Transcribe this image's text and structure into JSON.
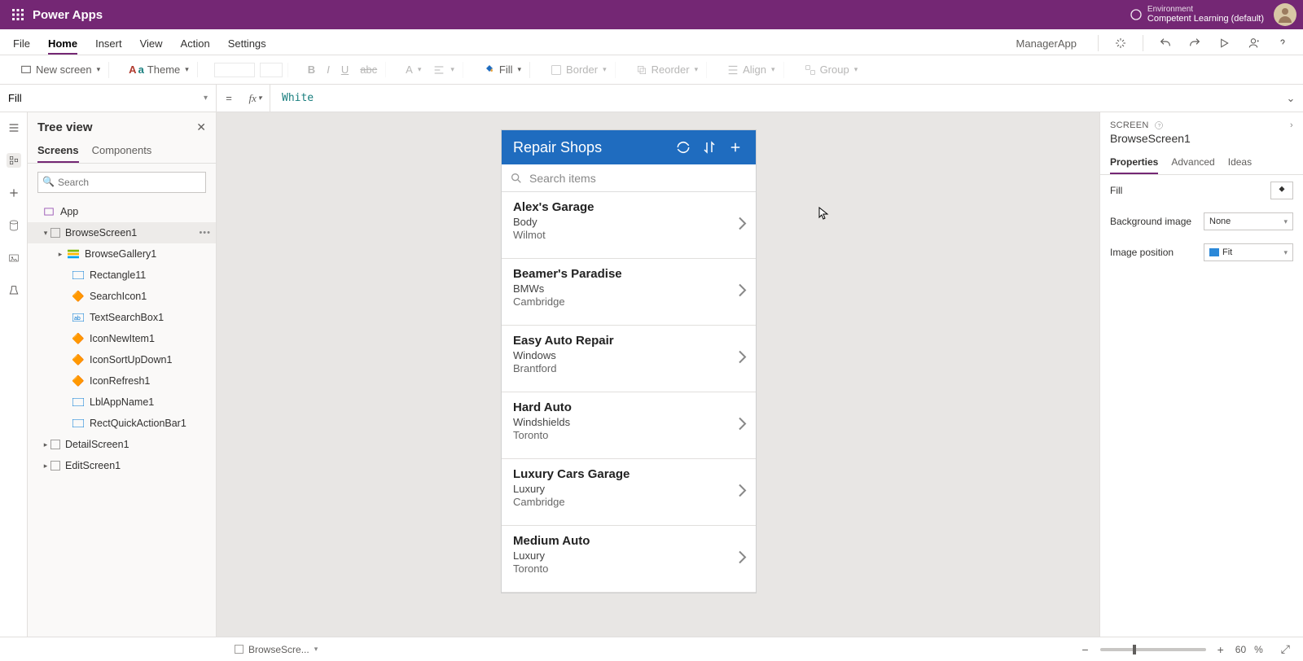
{
  "titlebar": {
    "app": "Power Apps",
    "env_label": "Environment",
    "env_name": "Competent Learning (default)"
  },
  "menubar": {
    "items": [
      "File",
      "Home",
      "Insert",
      "View",
      "Action",
      "Settings"
    ],
    "active_index": 1,
    "docname": "ManagerApp"
  },
  "ribbon": {
    "newscreen": "New screen",
    "theme": "Theme",
    "fill": "Fill",
    "border": "Border",
    "reorder": "Reorder",
    "align": "Align",
    "group": "Group"
  },
  "formula": {
    "property": "Fill",
    "expr": "White"
  },
  "tree": {
    "title": "Tree view",
    "tabs": [
      "Screens",
      "Components"
    ],
    "active_tab": 0,
    "search_ph": "Search",
    "app": "App",
    "screens": [
      {
        "name": "BrowseScreen1",
        "selected": true,
        "children": [
          {
            "name": "BrowseGallery1",
            "k": "gallery",
            "expandable": true
          },
          {
            "name": "Rectangle11",
            "k": "rect"
          },
          {
            "name": "SearchIcon1",
            "k": "icon"
          },
          {
            "name": "TextSearchBox1",
            "k": "text"
          },
          {
            "name": "IconNewItem1",
            "k": "icon"
          },
          {
            "name": "IconSortUpDown1",
            "k": "icon"
          },
          {
            "name": "IconRefresh1",
            "k": "icon"
          },
          {
            "name": "LblAppName1",
            "k": "label"
          },
          {
            "name": "RectQuickActionBar1",
            "k": "rect"
          }
        ]
      },
      {
        "name": "DetailScreen1"
      },
      {
        "name": "EditScreen1"
      }
    ]
  },
  "canvas": {
    "apptitle": "Repair Shops",
    "search_ph": "Search items",
    "items": [
      {
        "title": "Alex's Garage",
        "sub": "Body",
        "loc": "Wilmot"
      },
      {
        "title": "Beamer's Paradise",
        "sub": "BMWs",
        "loc": "Cambridge"
      },
      {
        "title": "Easy Auto Repair",
        "sub": "Windows",
        "loc": "Brantford"
      },
      {
        "title": "Hard Auto",
        "sub": "Windshields",
        "loc": "Toronto"
      },
      {
        "title": "Luxury Cars Garage",
        "sub": "Luxury",
        "loc": "Cambridge"
      },
      {
        "title": "Medium Auto",
        "sub": "Luxury",
        "loc": "Toronto"
      }
    ]
  },
  "props": {
    "heading": "SCREEN",
    "name": "BrowseScreen1",
    "tabs": [
      "Properties",
      "Advanced",
      "Ideas"
    ],
    "active_tab": 0,
    "rows": {
      "fill_label": "Fill",
      "bg_label": "Background image",
      "bg_value": "None",
      "pos_label": "Image position",
      "pos_value": "Fit"
    }
  },
  "status": {
    "selection": "BrowseScre...",
    "zoom": "60",
    "zoom_unit": "%"
  }
}
